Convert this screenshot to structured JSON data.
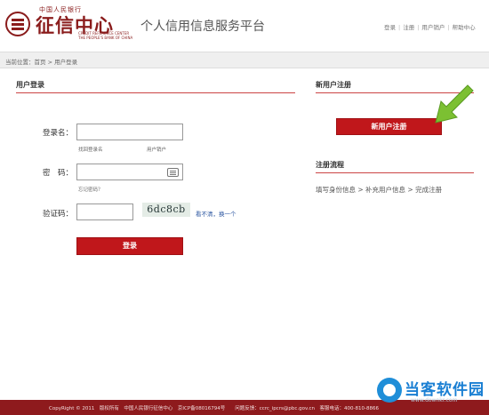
{
  "header": {
    "logo_top": "中国人民银行",
    "logo_name": "征信中心",
    "logo_en_line1": "CREDIT REFERENCE CENTER",
    "logo_en_line2": "THE PEOPLE'S BANK OF CHINA",
    "site_title": "个人信用信息服务平台",
    "links": [
      "登录",
      "注册",
      "用户销户",
      "帮助中心"
    ]
  },
  "breadcrumb": "当前位置：首页 > 用户登录",
  "login": {
    "section_title": "用户登录",
    "username_label": "登录名：",
    "username_value": "",
    "find_login_link": "找回登录名",
    "cancel_account_link": "用户销户",
    "password_label": "密　码：",
    "password_value": "",
    "forgot_password_link": "忘记密码？",
    "captcha_label": "验证码：",
    "captcha_value": "",
    "captcha_text": "6dc8cb",
    "refresh_link": "看不清，换一个",
    "submit_label": "登录"
  },
  "register": {
    "section_title": "新用户注册",
    "button_label": "新用户注册",
    "arrow_color": "#7cc032"
  },
  "flow": {
    "section_title": "注册流程",
    "steps_text": "填写身份信息 > 补充用户信息 > 完成注册"
  },
  "footer": {
    "text": "CopyRight © 2011　版权所有　中国人民银行征信中心　京ICP备08016794号　　问题反馈：ccrc_ipcrs@pbc.gov.cn　客服电话：400-810-8866"
  },
  "watermark": {
    "text": "当客软件园",
    "url": "www.downkr.com"
  },
  "colors": {
    "brand_red": "#8e1a1d",
    "button_red": "#c0171b",
    "link_blue": "#2a55a0"
  }
}
